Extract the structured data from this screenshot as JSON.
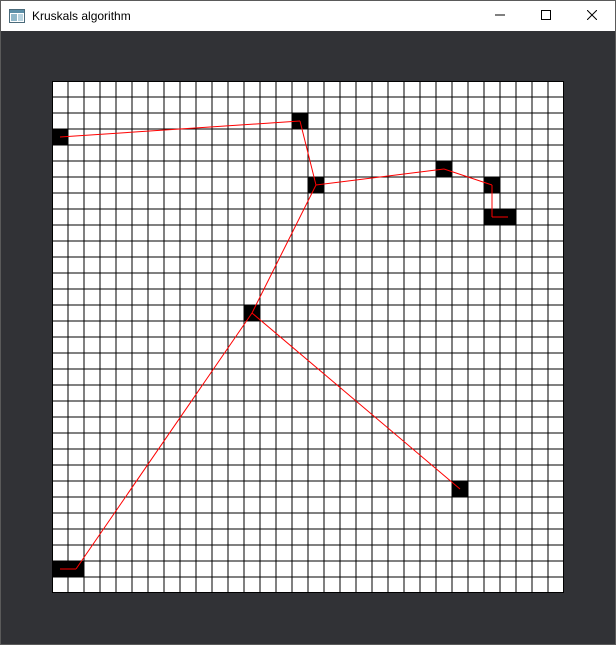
{
  "window": {
    "title": "Kruskals algorithm",
    "app_icon": "window-app-icon",
    "controls": {
      "minimize_icon": "minimize-icon",
      "maximize_icon": "maximize-icon",
      "close_icon": "close-icon"
    }
  },
  "colors": {
    "window_bg": "#313236",
    "cell_bg": "#ffffff",
    "grid_line": "#000000",
    "filled_cell": "#000000",
    "edge": "#ff0000"
  },
  "grid": {
    "columns": 32,
    "rows": 32,
    "filled_cells": [
      [
        0,
        3
      ],
      [
        15,
        2
      ],
      [
        16,
        6
      ],
      [
        24,
        5
      ],
      [
        27,
        6
      ],
      [
        27,
        8
      ],
      [
        28,
        8
      ],
      [
        12,
        14
      ],
      [
        25,
        25
      ],
      [
        0,
        30
      ],
      [
        1,
        30
      ]
    ],
    "edges": [
      [
        [
          0.5,
          3.5
        ],
        [
          15.5,
          2.5
        ]
      ],
      [
        [
          15.5,
          2.5
        ],
        [
          16.5,
          6.5
        ]
      ],
      [
        [
          16.5,
          6.5
        ],
        [
          24.5,
          5.5
        ]
      ],
      [
        [
          24.5,
          5.5
        ],
        [
          27.5,
          6.5
        ]
      ],
      [
        [
          27.5,
          6.5
        ],
        [
          27.5,
          8.5
        ]
      ],
      [
        [
          27.5,
          8.5
        ],
        [
          28.5,
          8.5
        ]
      ],
      [
        [
          16.5,
          6.5
        ],
        [
          12.5,
          14.5
        ]
      ],
      [
        [
          12.5,
          14.5
        ],
        [
          25.5,
          25.5
        ]
      ],
      [
        [
          12.5,
          14.5
        ],
        [
          1.5,
          30.5
        ]
      ],
      [
        [
          1.5,
          30.5
        ],
        [
          0.5,
          30.5
        ]
      ]
    ]
  }
}
